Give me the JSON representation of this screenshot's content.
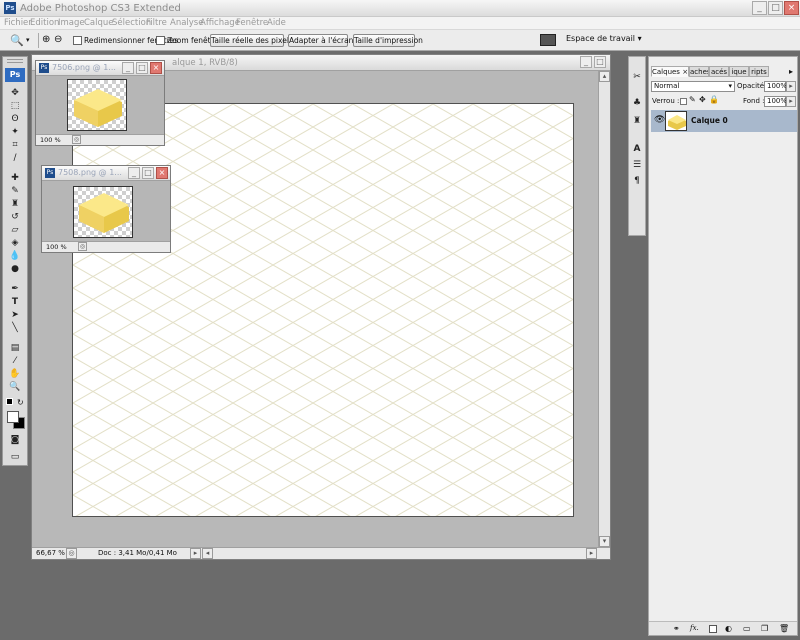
{
  "app": {
    "title": "Adobe Photoshop CS3 Extended"
  },
  "menu": [
    "Fichier",
    "Edition",
    "Image",
    "Calque",
    "Sélection",
    "Filtre",
    "Analyse",
    "Affichage",
    "Fenêtre",
    "Aide"
  ],
  "options": {
    "resize_windows": "Redimensionner fenêtres",
    "zoom_windows": "Zoom fenêtres",
    "actual_pixels": "Taille réelle des pixels",
    "fit_screen": "Adapter à l'écran",
    "print_size": "Taille d'impression",
    "workspace": "Espace de travail"
  },
  "document": {
    "title": "alque 1, RVB/8)",
    "zoom": "66,67 %",
    "doc_info": "Doc : 3,41 Mo/0,41 Mo"
  },
  "mini_windows": [
    {
      "title": "7506.png @ 1...",
      "zoom": "100 %"
    },
    {
      "title": "7508.png @ 1...",
      "zoom": "100 %"
    }
  ],
  "layers_panel": {
    "tabs": [
      "Calques",
      "aches",
      "acés",
      "ique",
      "ripts"
    ],
    "blend_mode": "Normal",
    "opacity_label": "Opacité :",
    "opacity_value": "100%",
    "lock_label": "Verrou :",
    "fill_label": "Fond :",
    "fill_value": "100%",
    "layers": [
      {
        "name": "Calque 0",
        "visible": true
      }
    ]
  },
  "icons": {
    "ps_logo": "Ps",
    "fx": "fx."
  },
  "colors": {
    "accent": "#2f6cc1",
    "cube": "#f5e27a",
    "grid": "#e3e0c8"
  }
}
